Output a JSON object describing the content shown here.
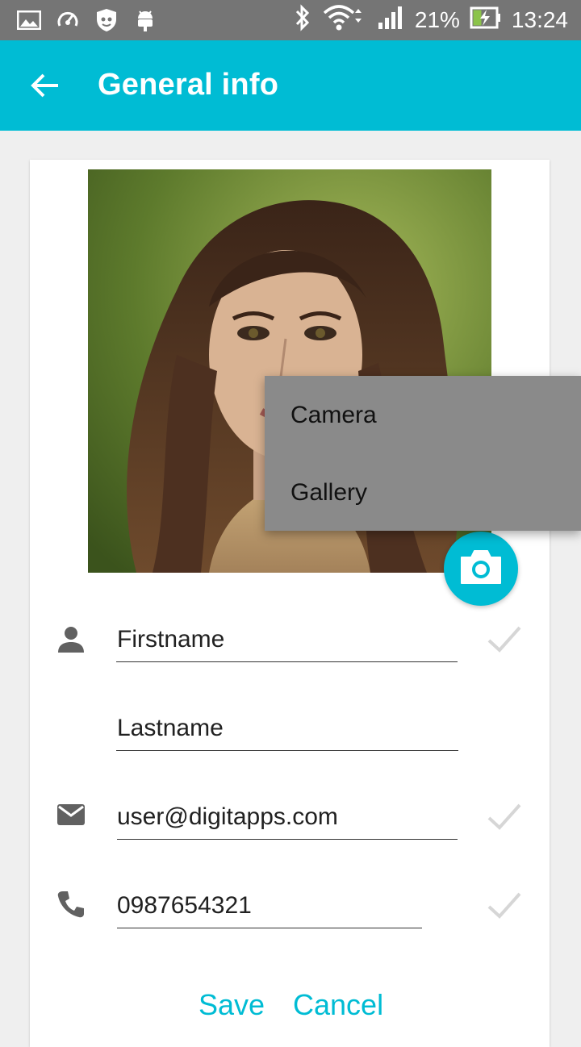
{
  "status_bar": {
    "battery": "21%",
    "time": "13:24"
  },
  "app_bar": {
    "title": "General info",
    "back_icon": "arrow-back-icon"
  },
  "profile": {
    "photo": "profile-photo",
    "camera_button_icon": "camera-icon"
  },
  "photo_menu": {
    "items": [
      "Camera",
      "Gallery"
    ]
  },
  "form": {
    "firstname": "Firstname",
    "lastname": "Lastname",
    "email": "user@digitapps.com",
    "phone": "0987654321"
  },
  "actions": {
    "save": "Save",
    "cancel": "Cancel"
  },
  "colors": {
    "accent": "#00bcd4",
    "status_bar": "#757575",
    "menu": "#8a8a8a"
  }
}
